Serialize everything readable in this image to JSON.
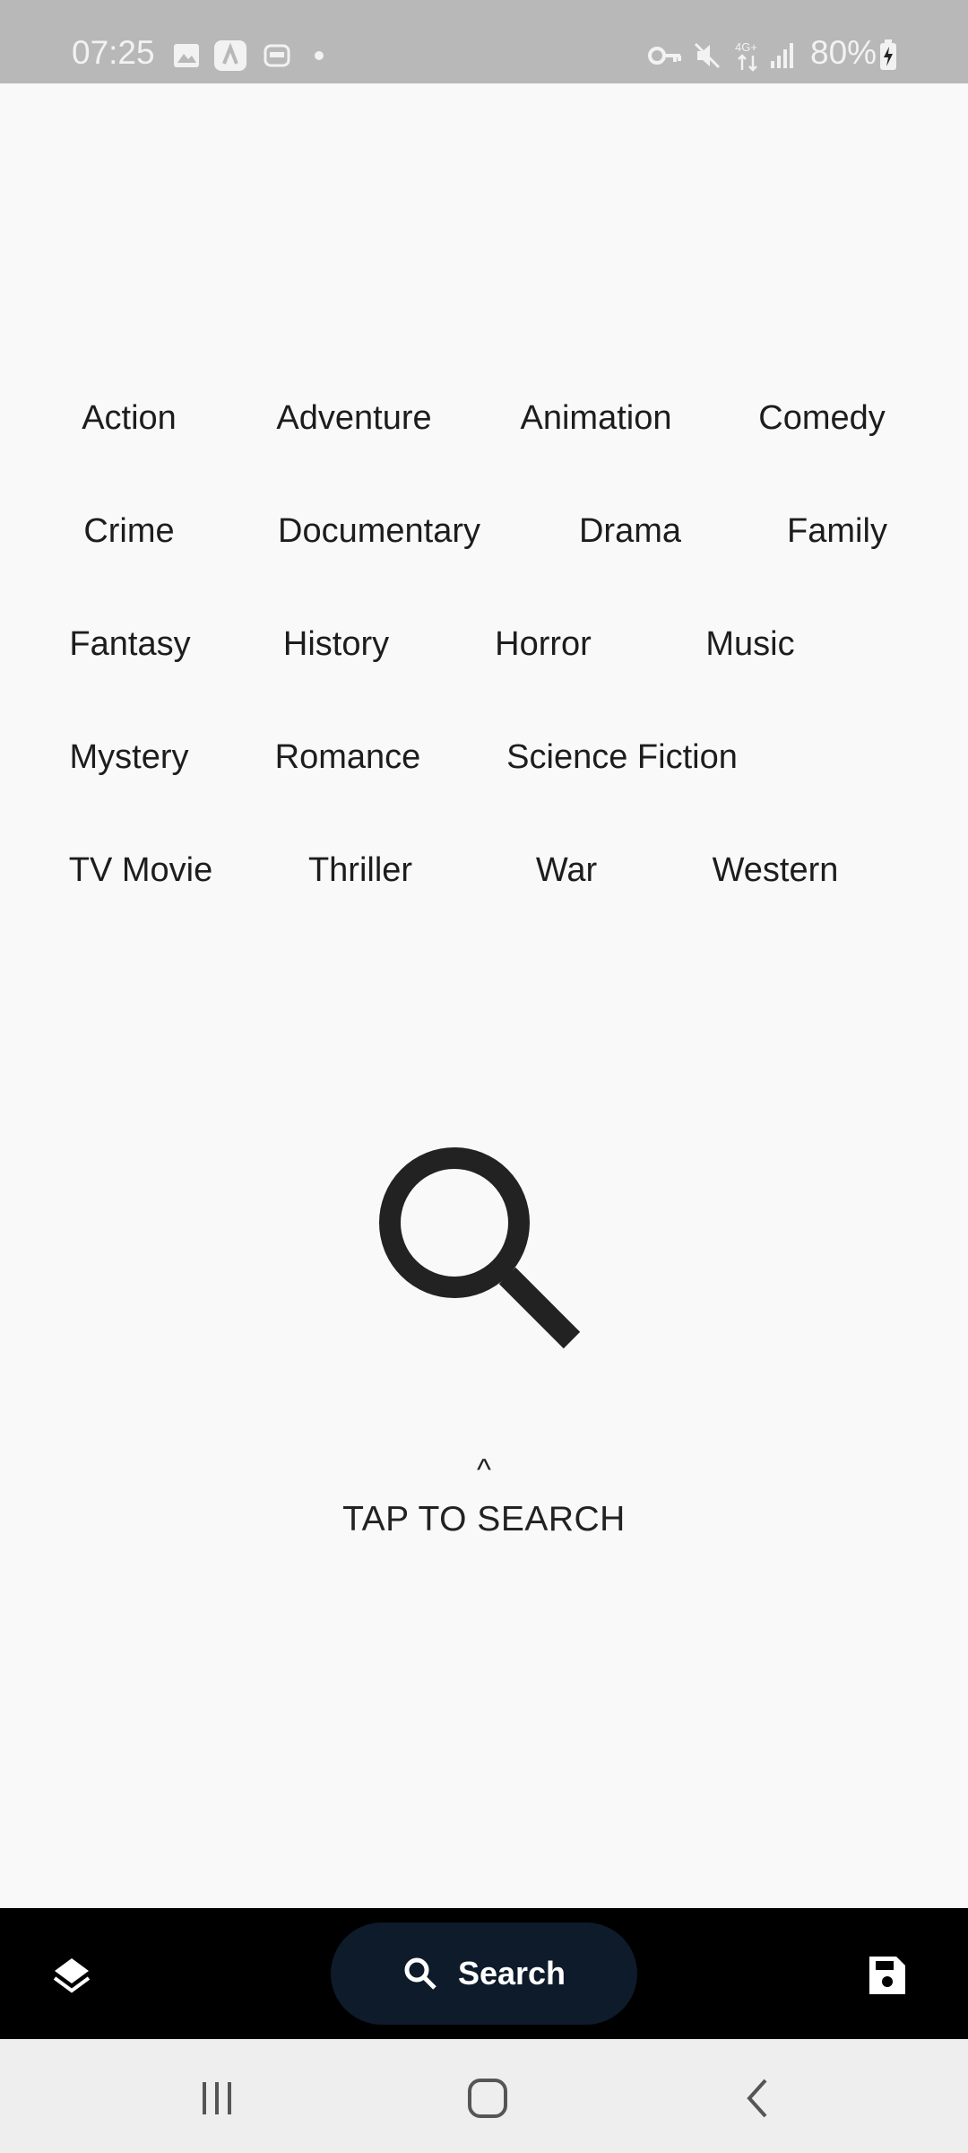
{
  "status_bar": {
    "time": "07:25",
    "battery": "80%",
    "icons": [
      "image-icon",
      "app-icon",
      "robot-icon",
      "dot-icon",
      "vpn-key-icon",
      "mute-icon",
      "4g-icon",
      "signal-icon",
      "battery-charging-icon"
    ]
  },
  "genres": [
    "Action",
    "Adventure",
    "Animation",
    "Comedy",
    "Crime",
    "Documentary",
    "Drama",
    "Family",
    "Fantasy",
    "History",
    "Horror",
    "Music",
    "Mystery",
    "Romance",
    "Science Fiction",
    "TV Movie",
    "Thriller",
    "War",
    "Western"
  ],
  "center": {
    "icon": "search-icon",
    "caret": "^",
    "hint": "TAP TO SEARCH"
  },
  "bottom_bar": {
    "left_icon": "layers-icon",
    "search_label": "Search",
    "right_icon": "save-icon"
  },
  "nav_bar": {
    "icons": [
      "recents-icon",
      "home-icon",
      "back-icon"
    ]
  },
  "colors": {
    "background": "#f9f9f9",
    "status_bar": "#b8b8b8",
    "bottom_bar": "#000000",
    "search_pill": "#0d1b2a",
    "text": "#1d1d1d"
  }
}
